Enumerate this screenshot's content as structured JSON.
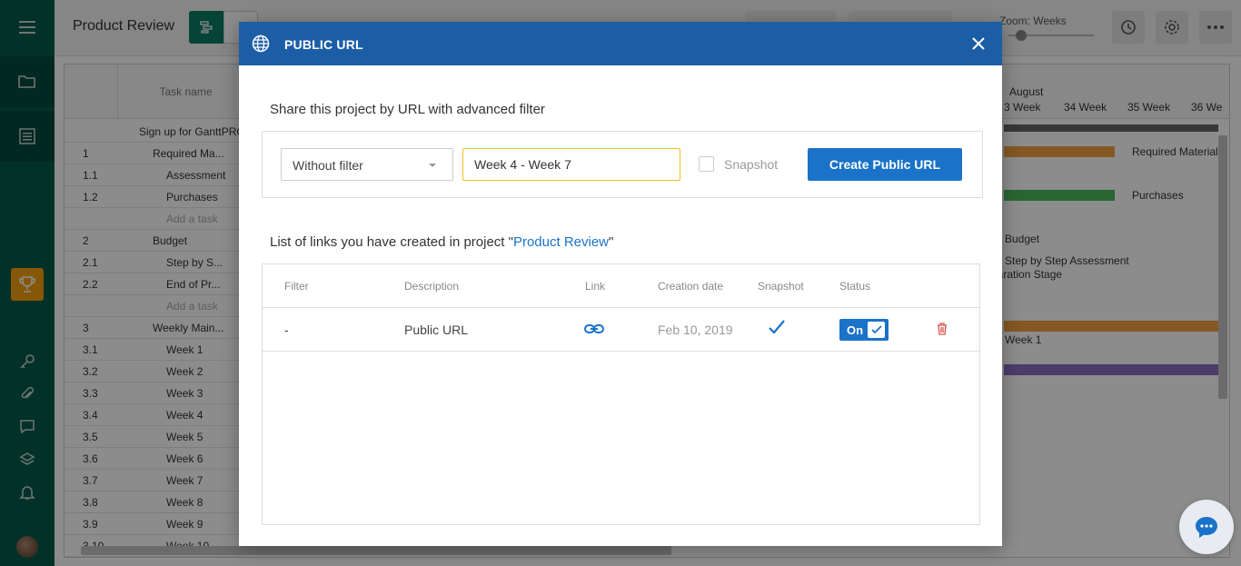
{
  "app": {
    "project_title": "Product Review",
    "zoom_label": "Zoom: Weeks"
  },
  "grid": {
    "task_name_header": "Task name",
    "rows": [
      {
        "num": "",
        "name": "Sign up for GanttPRO"
      },
      {
        "num": "1",
        "name": "Required Ma..."
      },
      {
        "num": "1.1",
        "name": "Assessment"
      },
      {
        "num": "1.2",
        "name": "Purchases"
      },
      {
        "num": "",
        "name": "Add a task"
      },
      {
        "num": "2",
        "name": "Budget"
      },
      {
        "num": "2.1",
        "name": "Step by S..."
      },
      {
        "num": "2.2",
        "name": "End of Pr..."
      },
      {
        "num": "",
        "name": "Add a task"
      },
      {
        "num": "3",
        "name": "Weekly Main..."
      },
      {
        "num": "3.1",
        "name": "Week 1"
      },
      {
        "num": "3.2",
        "name": "Week 2"
      },
      {
        "num": "3.3",
        "name": "Week 3"
      },
      {
        "num": "3.4",
        "name": "Week 4"
      },
      {
        "num": "3.5",
        "name": "Week 5"
      },
      {
        "num": "3.6",
        "name": "Week 6"
      },
      {
        "num": "3.7",
        "name": "Week 7"
      },
      {
        "num": "3.8",
        "name": "Week 8"
      },
      {
        "num": "3.9",
        "name": "Week 9"
      },
      {
        "num": "3.10",
        "name": "Week 10"
      }
    ],
    "month": "August",
    "weeks": [
      "3 Week",
      "34 Week",
      "35 Week",
      "36 We"
    ],
    "bar_labels": {
      "required": "Required Material",
      "purchases": "Purchases",
      "budget": "Budget",
      "step": "Step by Step Assessment",
      "stage": "paration Stage",
      "week1": "Week 1"
    }
  },
  "modal": {
    "title": "PUBLIC URL",
    "share_title": "Share this project by URL with advanced filter",
    "filter_select": "Without filter",
    "filter_input_value": "Week 4 - Week 7",
    "snapshot_label": "Snapshot",
    "create_button": "Create Public URL",
    "list_title_prefix": "List of links you have created in project \"",
    "list_title_project": "Product Review",
    "list_title_suffix": "\"",
    "columns": [
      "Filter",
      "Description",
      "Link",
      "Creation date",
      "Snapshot",
      "Status"
    ],
    "links": [
      {
        "filter": "-",
        "description": "Public URL",
        "creation_date": "Feb 10, 2019",
        "snapshot": true,
        "status": "On"
      }
    ]
  },
  "colors": {
    "header_blue": "#1c5ea6",
    "accent_blue": "#1a73c8",
    "sidebar_green": "#045a4a",
    "trophy_orange": "#f59e0b",
    "delete_red": "#d9534f"
  }
}
